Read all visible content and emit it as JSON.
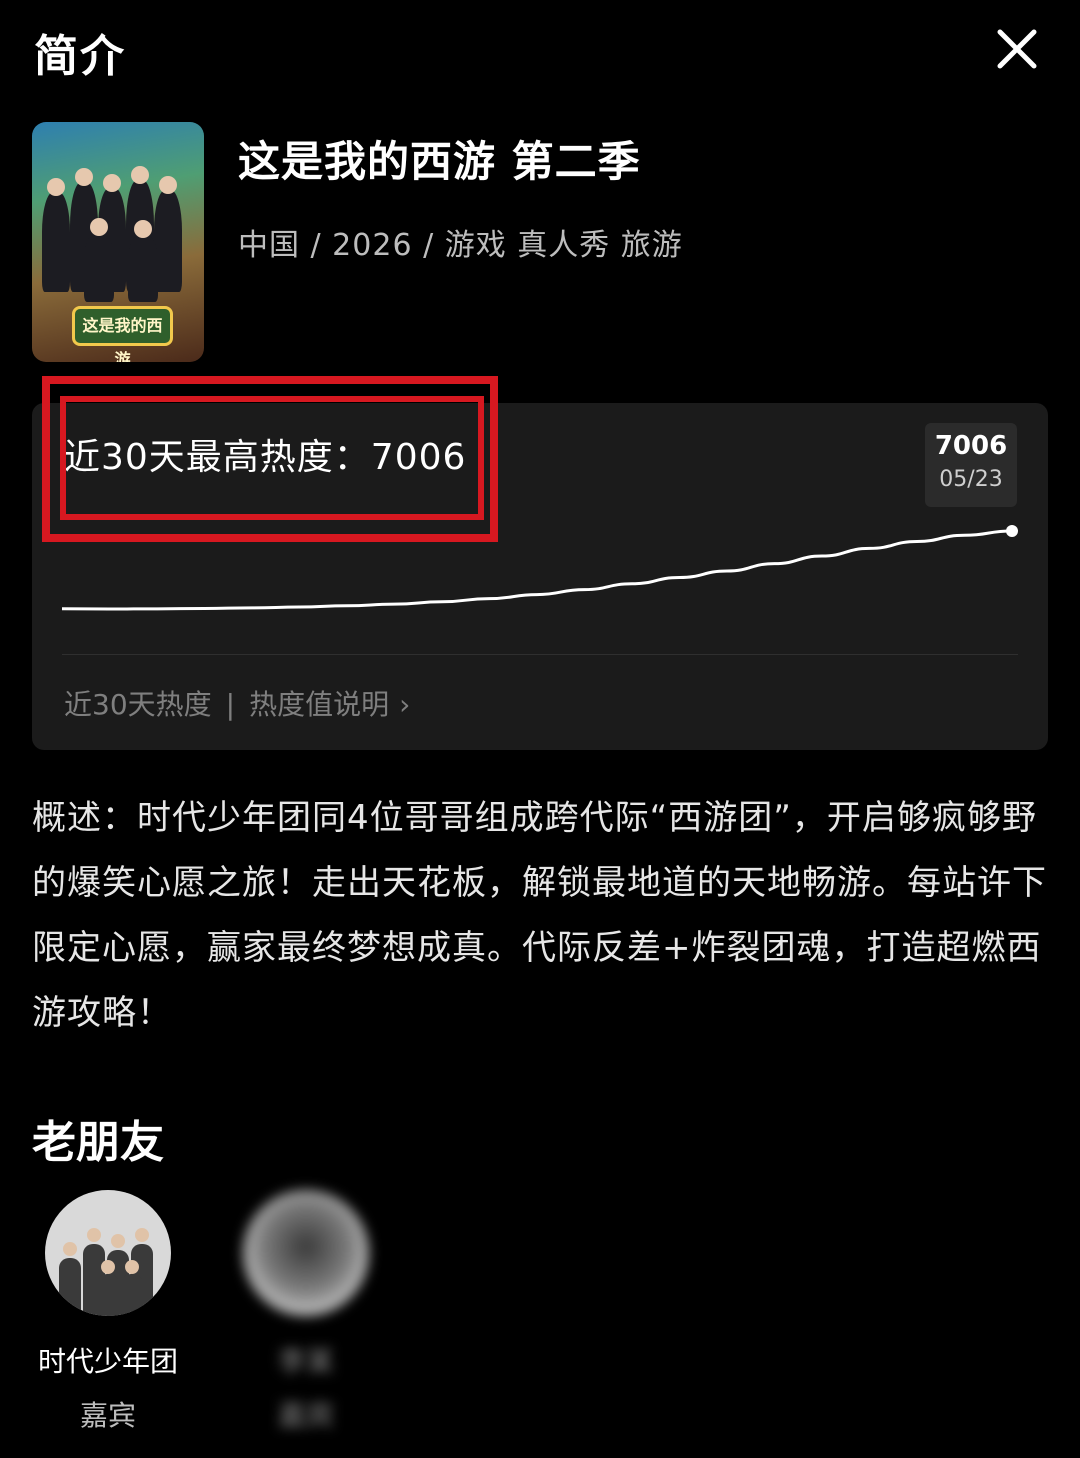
{
  "header": {
    "title": "简介"
  },
  "show": {
    "title": "这是我的西游 第二季",
    "meta": "中国 / 2026 / 游戏 真人秀 旅游",
    "poster_logo": "这是我的西游"
  },
  "heat": {
    "peak_label": "近30天最高热度：7006",
    "tooltip_value": "7006",
    "tooltip_date": "05/23",
    "footer_label": "近30天热度",
    "footer_sep": "|",
    "footer_link": "热度值说明",
    "footer_chevron": "›"
  },
  "summary": "概述：时代少年团同4位哥哥组成跨代际“西游团”，开启够疯够野的爆笑心愿之旅！走出天花板，解锁最地道的天地畅游。每站许下限定心愿，赢家最终梦想成真。代际反差+炸裂团魂，打造超燃西游攻略！",
  "friends": {
    "title": "老朋友",
    "items": [
      {
        "name": "时代少年团",
        "role": "嘉宾"
      },
      {
        "name": "李某",
        "role": "嘉宾"
      }
    ]
  },
  "chart_data": {
    "type": "line",
    "title": "近30天最高热度：7006",
    "series": [
      {
        "values": [
          1400,
          1380,
          1390,
          1420,
          1460,
          1520,
          1610,
          1730,
          1900,
          2130,
          2420,
          2780,
          3200,
          3650,
          4120,
          4650,
          5200,
          5750,
          6250,
          6700,
          7006
        ]
      }
    ],
    "ylim": [
      0,
      7006
    ],
    "last_label": {
      "value": 7006,
      "date": "05/23"
    },
    "grid": false
  },
  "colors": {
    "accent_red": "#d71820",
    "card_bg": "#1b1b1b",
    "line": "#ffffff"
  }
}
